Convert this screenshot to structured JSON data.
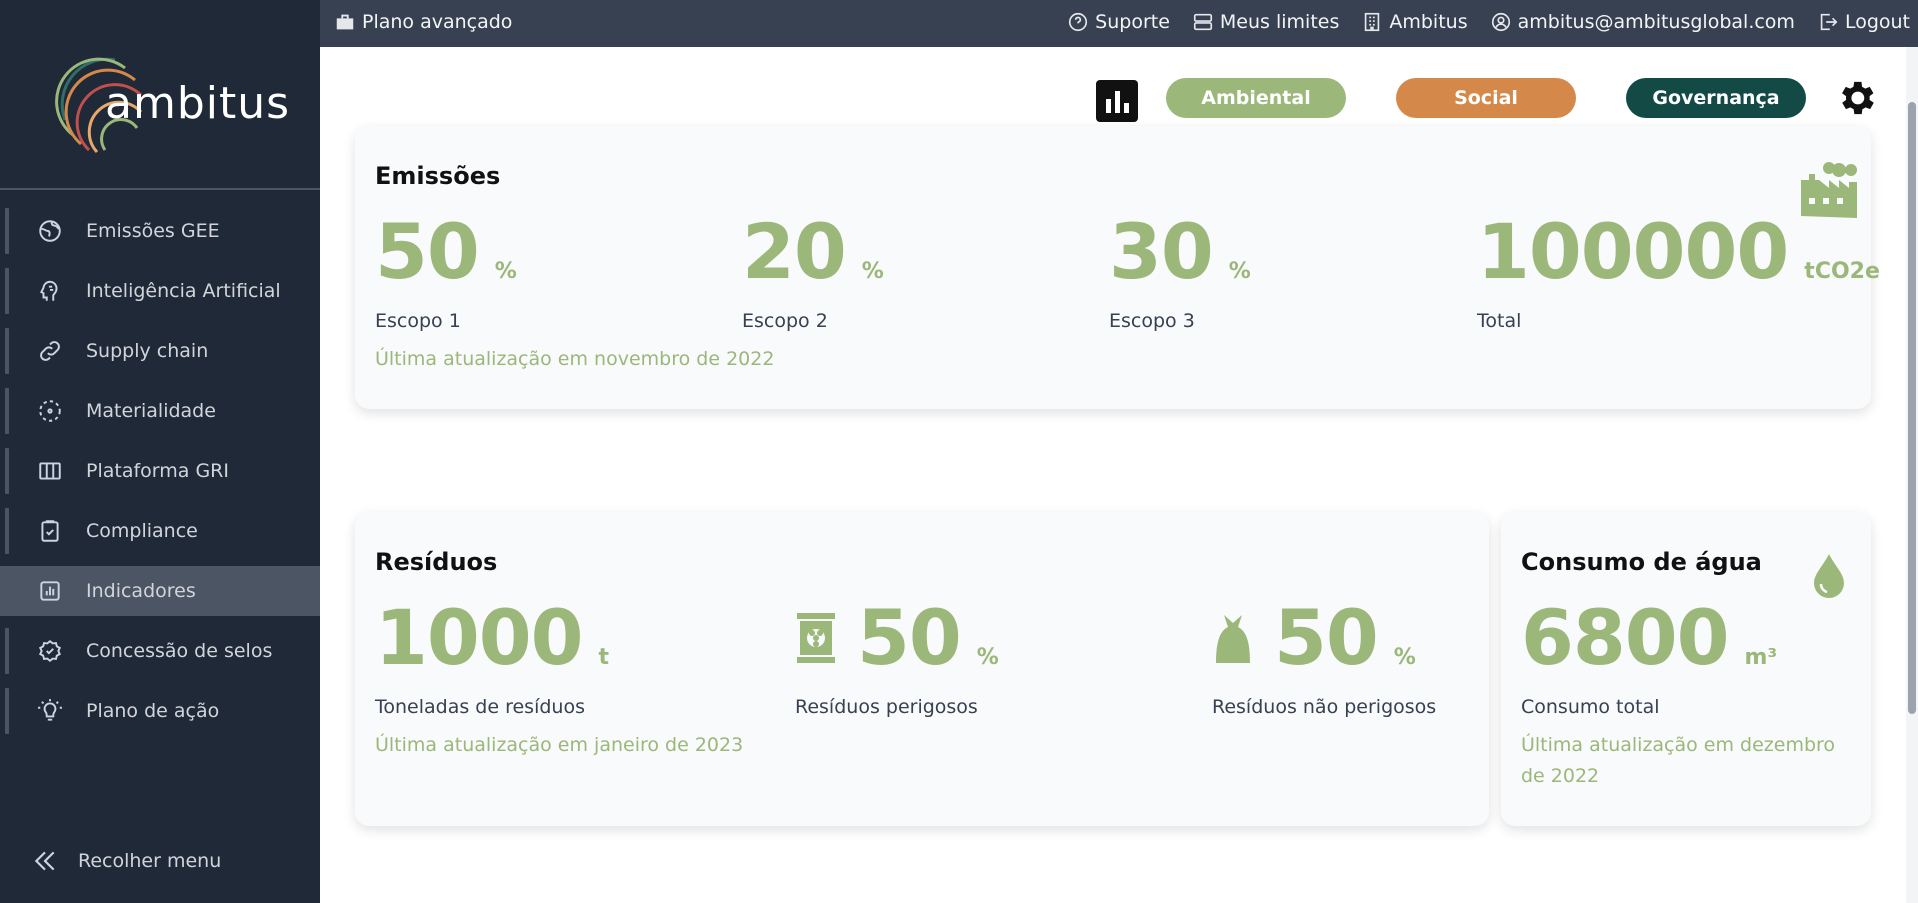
{
  "brand": {
    "name": "ambitus"
  },
  "topbar": {
    "plan": "Plano avançado",
    "support": "Suporte",
    "limits": "Meus limites",
    "org": "Ambitus",
    "email": "ambitus@ambitusglobal.com",
    "logout": "Logout"
  },
  "sidebar": {
    "items": [
      {
        "label": "Emissões GEE",
        "icon": "globe-icon"
      },
      {
        "label": "Inteligência Artificial",
        "icon": "brain-icon"
      },
      {
        "label": "Supply chain",
        "icon": "link-icon"
      },
      {
        "label": "Materialidade",
        "icon": "dashed-circle-icon"
      },
      {
        "label": "Plataforma GRI",
        "icon": "columns-icon"
      },
      {
        "label": "Compliance",
        "icon": "clipboard-check-icon"
      },
      {
        "label": "Indicadores",
        "icon": "chart-bar-icon",
        "active": true
      },
      {
        "label": "Concessão de selos",
        "icon": "badge-check-icon"
      },
      {
        "label": "Plano de ação",
        "icon": "lightbulb-icon"
      }
    ],
    "collapse": "Recolher menu"
  },
  "filters": {
    "ambiental": "Ambiental",
    "social": "Social",
    "governanca": "Governança"
  },
  "colors": {
    "green": "#9bb77a",
    "orange": "#d4894a",
    "dark_teal": "#134a45",
    "sidebar": "#1f2937"
  },
  "emissoes": {
    "title": "Emissões",
    "scope1": {
      "value": "50",
      "unit": "%",
      "label": "Escopo 1"
    },
    "scope2": {
      "value": "20",
      "unit": "%",
      "label": "Escopo 2"
    },
    "scope3": {
      "value": "30",
      "unit": "%",
      "label": "Escopo 3"
    },
    "total": {
      "value": "100000",
      "unit": "tCO2e",
      "label": "Total"
    },
    "updated": "Última atualização em novembro de 2022"
  },
  "residuos": {
    "title": "Resíduos",
    "tons": {
      "value": "1000",
      "unit": "t",
      "label": "Toneladas de resíduos"
    },
    "dangerous": {
      "value": "50",
      "unit": "%",
      "label": "Resíduos perigosos"
    },
    "non_dangerous": {
      "value": "50",
      "unit": "%",
      "label": "Resíduos não perigosos"
    },
    "updated": "Última atualização em janeiro de 2023"
  },
  "agua": {
    "title": "Consumo de água",
    "total": {
      "value": "6800",
      "unit": "m³",
      "label": "Consumo total"
    },
    "updated": "Última atualização em dezembro de 2022"
  }
}
